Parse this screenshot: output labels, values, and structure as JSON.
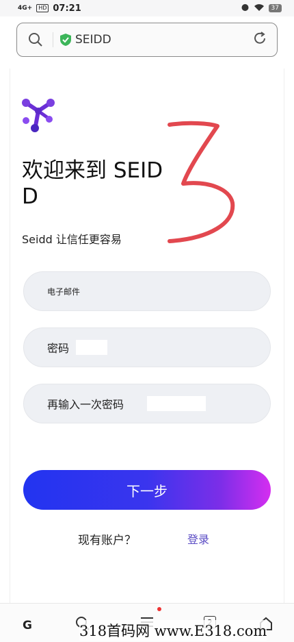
{
  "status_bar": {
    "network": "4G+",
    "badge": "HD",
    "time": "07:21",
    "battery": "37"
  },
  "browser": {
    "address_text": "SEIDD",
    "icons": [
      "search-icon",
      "shield-check-icon",
      "reload-icon"
    ],
    "secure_color": "#3cb55a"
  },
  "page": {
    "welcome": "欢迎来到 SEIDD",
    "tagline": "Seidd 让信任更容易",
    "fields": {
      "email_label": "电子邮件",
      "password_label": "密码",
      "confirm_label": "再输入一次密码"
    },
    "next_button": "下一步",
    "have_account": "现有账户？",
    "login_link": "登录",
    "colors": {
      "button_start": "#2234f0",
      "button_end": "#d52ef0",
      "link": "#5a4bc4",
      "logo_purple": "#6b2fd6"
    }
  },
  "bottom_nav": {
    "g_label": "G",
    "tab_count": "2",
    "icons": [
      "search-icon",
      "menu-icon",
      "tabs-icon",
      "home-icon"
    ]
  },
  "watermark": "318首码网 www.E318.com"
}
